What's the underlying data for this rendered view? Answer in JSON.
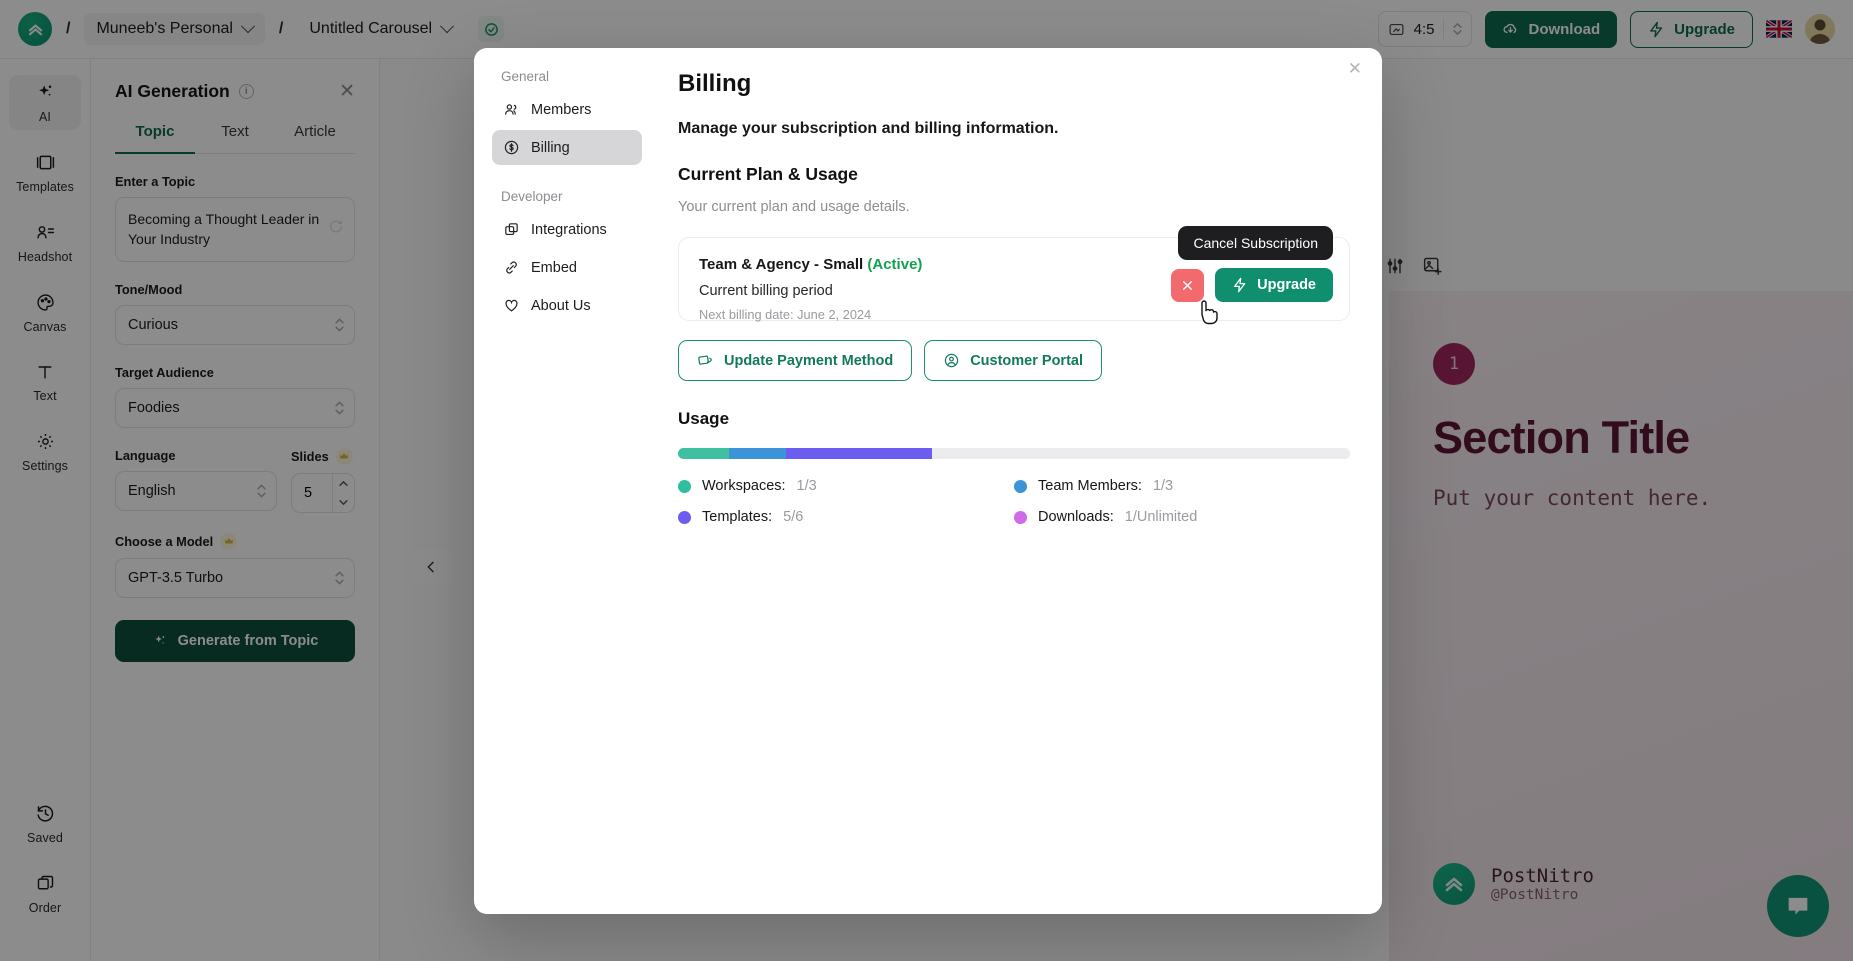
{
  "topbar": {
    "logo_icon": "postnitro-chevron-logo",
    "workspace": "Muneeb's Personal",
    "separator": "/",
    "document": "Untitled Carousel",
    "saved_icon": "check-circle-icon",
    "ratio_icon": "aspect-ratio-icon",
    "ratio_value": "4:5",
    "download_label": "Download",
    "download_icon": "cloud-download-icon",
    "upgrade_label": "Upgrade",
    "upgrade_icon": "lightning-bolt-icon",
    "flag_icon": "uk-flag-icon",
    "avatar_icon": "user-avatar"
  },
  "rail": {
    "items": [
      {
        "label": "AI",
        "icon": "sparkles-icon",
        "active": true
      },
      {
        "label": "Templates",
        "icon": "layout-panels-icon",
        "active": false
      },
      {
        "label": "Headshot",
        "icon": "user-list-icon",
        "active": false
      },
      {
        "label": "Canvas",
        "icon": "palette-icon",
        "active": false
      },
      {
        "label": "Text",
        "icon": "text-t-icon",
        "active": false
      },
      {
        "label": "Settings",
        "icon": "gear-icon",
        "active": false
      }
    ],
    "bottom_items": [
      {
        "label": "Saved",
        "icon": "history-clock-icon"
      },
      {
        "label": "Order",
        "icon": "layers-copy-icon"
      }
    ]
  },
  "panel": {
    "title": "AI Generation",
    "info_icon": "info-icon",
    "close_icon": "close-icon",
    "tabs": [
      {
        "label": "Topic",
        "active": true
      },
      {
        "label": "Text",
        "active": false
      },
      {
        "label": "Article",
        "active": false
      }
    ],
    "topic": {
      "label": "Enter a Topic",
      "value": "Becoming a Thought Leader in Your Industry",
      "refresh_icon": "refresh-icon"
    },
    "tone": {
      "label": "Tone/Mood",
      "value": "Curious"
    },
    "audience": {
      "label": "Target Audience",
      "value": "Foodies"
    },
    "language": {
      "label": "Language",
      "value": "English"
    },
    "slides": {
      "label": "Slides",
      "value": "5",
      "badge_icon": "crown-icon"
    },
    "model": {
      "label": "Choose a Model",
      "value": "GPT-3.5 Turbo",
      "badge_icon": "crown-icon"
    },
    "generate_label": "Generate from Topic",
    "generate_icon": "sparkles-icon"
  },
  "canvas": {
    "toolbar_icons": [
      "sliders-icon",
      "add-image-icon",
      "chevron-right-icon",
      "duplicate-icon",
      "trash-icon",
      "add-circle-icon"
    ],
    "slide": {
      "number": "1",
      "title": "Section Title",
      "body": "Put your content here.",
      "brand_name": "PostNitro",
      "brand_handle": "@PostNitro",
      "brand_icon": "postnitro-chevron-logo"
    },
    "nav_prev_icon": "chevron-left-icon",
    "nav_next_icon": "chevron-right-icon",
    "chat_icon": "chat-bubble-icon"
  },
  "modal": {
    "close_icon": "close-icon",
    "sidebar": {
      "groups": [
        {
          "label": "General",
          "items": [
            {
              "label": "Members",
              "icon": "members-icon",
              "active": false
            },
            {
              "label": "Billing",
              "icon": "billing-dollar-icon",
              "active": true
            }
          ]
        },
        {
          "label": "Developer",
          "items": [
            {
              "label": "Integrations",
              "icon": "integrations-icon",
              "active": false
            },
            {
              "label": "Embed",
              "icon": "link-icon",
              "active": false
            },
            {
              "label": "About Us",
              "icon": "heart-icon",
              "active": false
            }
          ]
        }
      ]
    },
    "title": "Billing",
    "subtitle": "Manage your subscription and billing information.",
    "section_plan_title": "Current Plan & Usage",
    "section_plan_note": "Your current plan and usage details.",
    "plan": {
      "name": "Team & Agency - Small",
      "status": "(Active)",
      "period": "Current billing period",
      "next_billing": "Next billing date: June 2, 2024",
      "cancel_tooltip": "Cancel Subscription",
      "cancel_icon": "close-icon",
      "upgrade_label": "Upgrade",
      "upgrade_icon": "lightning-bolt-icon"
    },
    "payment_buttons": [
      {
        "label": "Update Payment Method",
        "icon": "credit-cards-icon"
      },
      {
        "label": "Customer Portal",
        "icon": "user-circle-icon"
      }
    ],
    "usage": {
      "title": "Usage",
      "bar_segments": [
        {
          "color": "#3fc0a0",
          "width_pct": 7.6
        },
        {
          "color": "#3b93d8",
          "width_pct": 8.4
        },
        {
          "color": "#6c5cf0",
          "width_pct": 21.8
        },
        {
          "color": "#ececee",
          "width_pct": 62.2
        }
      ],
      "items": [
        {
          "label": "Workspaces:",
          "value": "1/3",
          "color": "#2fbf9e"
        },
        {
          "label": "Team Members:",
          "value": "1/3",
          "color": "#3b93d8"
        },
        {
          "label": "Templates:",
          "value": "5/6",
          "color": "#6c5cf0"
        },
        {
          "label": "Downloads:",
          "value": "1/Unlimited",
          "color": "#d06ae8"
        }
      ]
    }
  },
  "colors": {
    "brand_green": "#0d6b4f",
    "accent_green": "#0f8f6e",
    "danger_red": "#f2696e",
    "active_green": "#12a150"
  }
}
